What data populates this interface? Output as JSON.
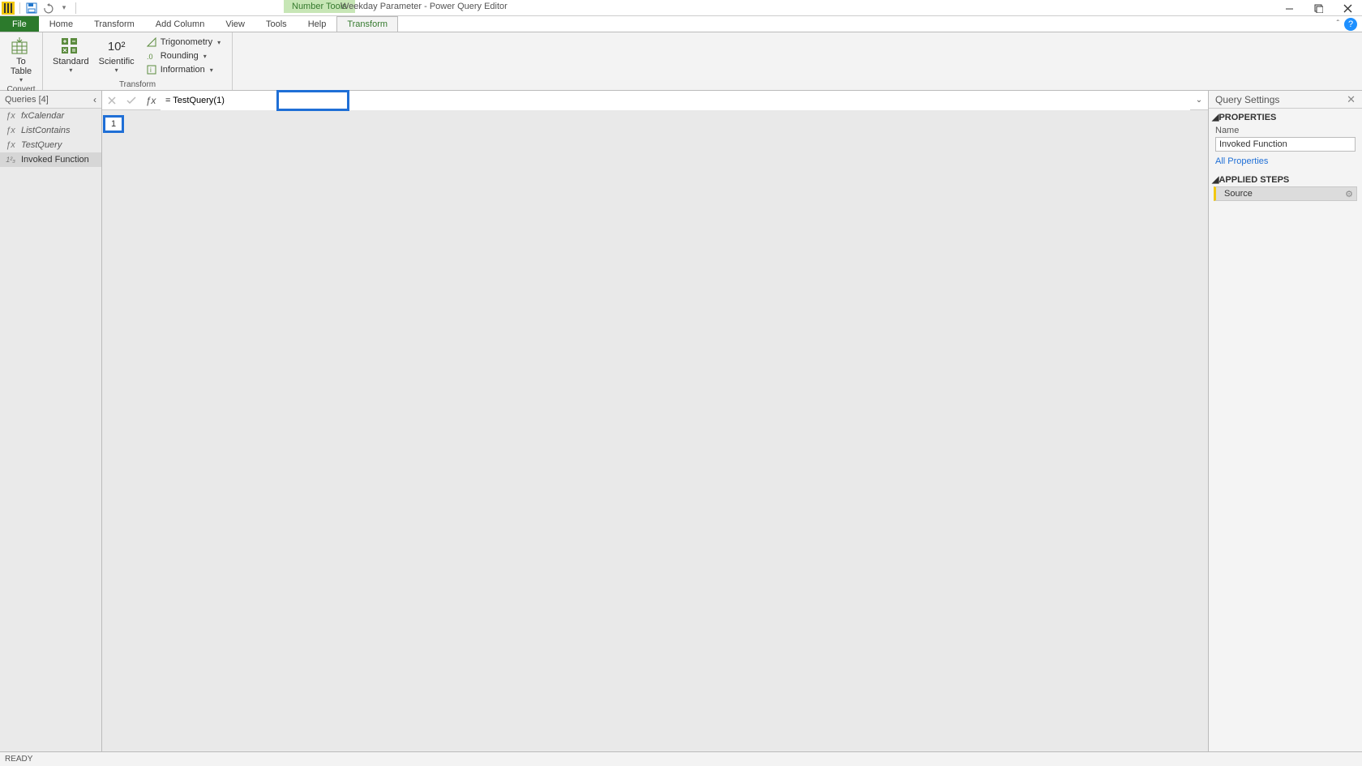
{
  "titlebar": {
    "context_tool_label": "Number Tools",
    "document_title": "Weekday Parameter - Power Query Editor"
  },
  "ribbon_tabs": {
    "file": "File",
    "home": "Home",
    "transform": "Transform",
    "add_column": "Add Column",
    "view": "View",
    "tools": "Tools",
    "help": "Help",
    "ctx_transform": "Transform"
  },
  "ribbon": {
    "convert_group": "Convert",
    "to_table": "To\nTable",
    "transform_group": "Transform",
    "standard": "Standard",
    "scientific": "Scientific",
    "sci_glyph": "10²",
    "trigonometry": "Trigonometry",
    "rounding": "Rounding",
    "information": "Information"
  },
  "queries_panel": {
    "header": "Queries [4]",
    "items": [
      {
        "icon": "fx",
        "label": "fxCalendar",
        "italic": true
      },
      {
        "icon": "fx",
        "label": "ListContains",
        "italic": true
      },
      {
        "icon": "fx",
        "label": "TestQuery",
        "italic": true
      },
      {
        "icon": "123",
        "label": "Invoked Function",
        "selected": true
      }
    ]
  },
  "formula_bar": {
    "text": "= TestQuery(1)"
  },
  "result": {
    "value": "1"
  },
  "settings_panel": {
    "header": "Query Settings",
    "properties_label": "PROPERTIES",
    "name_label": "Name",
    "name_value": "Invoked Function",
    "all_properties": "All Properties",
    "applied_steps_label": "APPLIED STEPS",
    "steps": [
      {
        "label": "Source",
        "selected": true,
        "has_gear": true
      }
    ]
  },
  "status": {
    "text": "READY"
  }
}
